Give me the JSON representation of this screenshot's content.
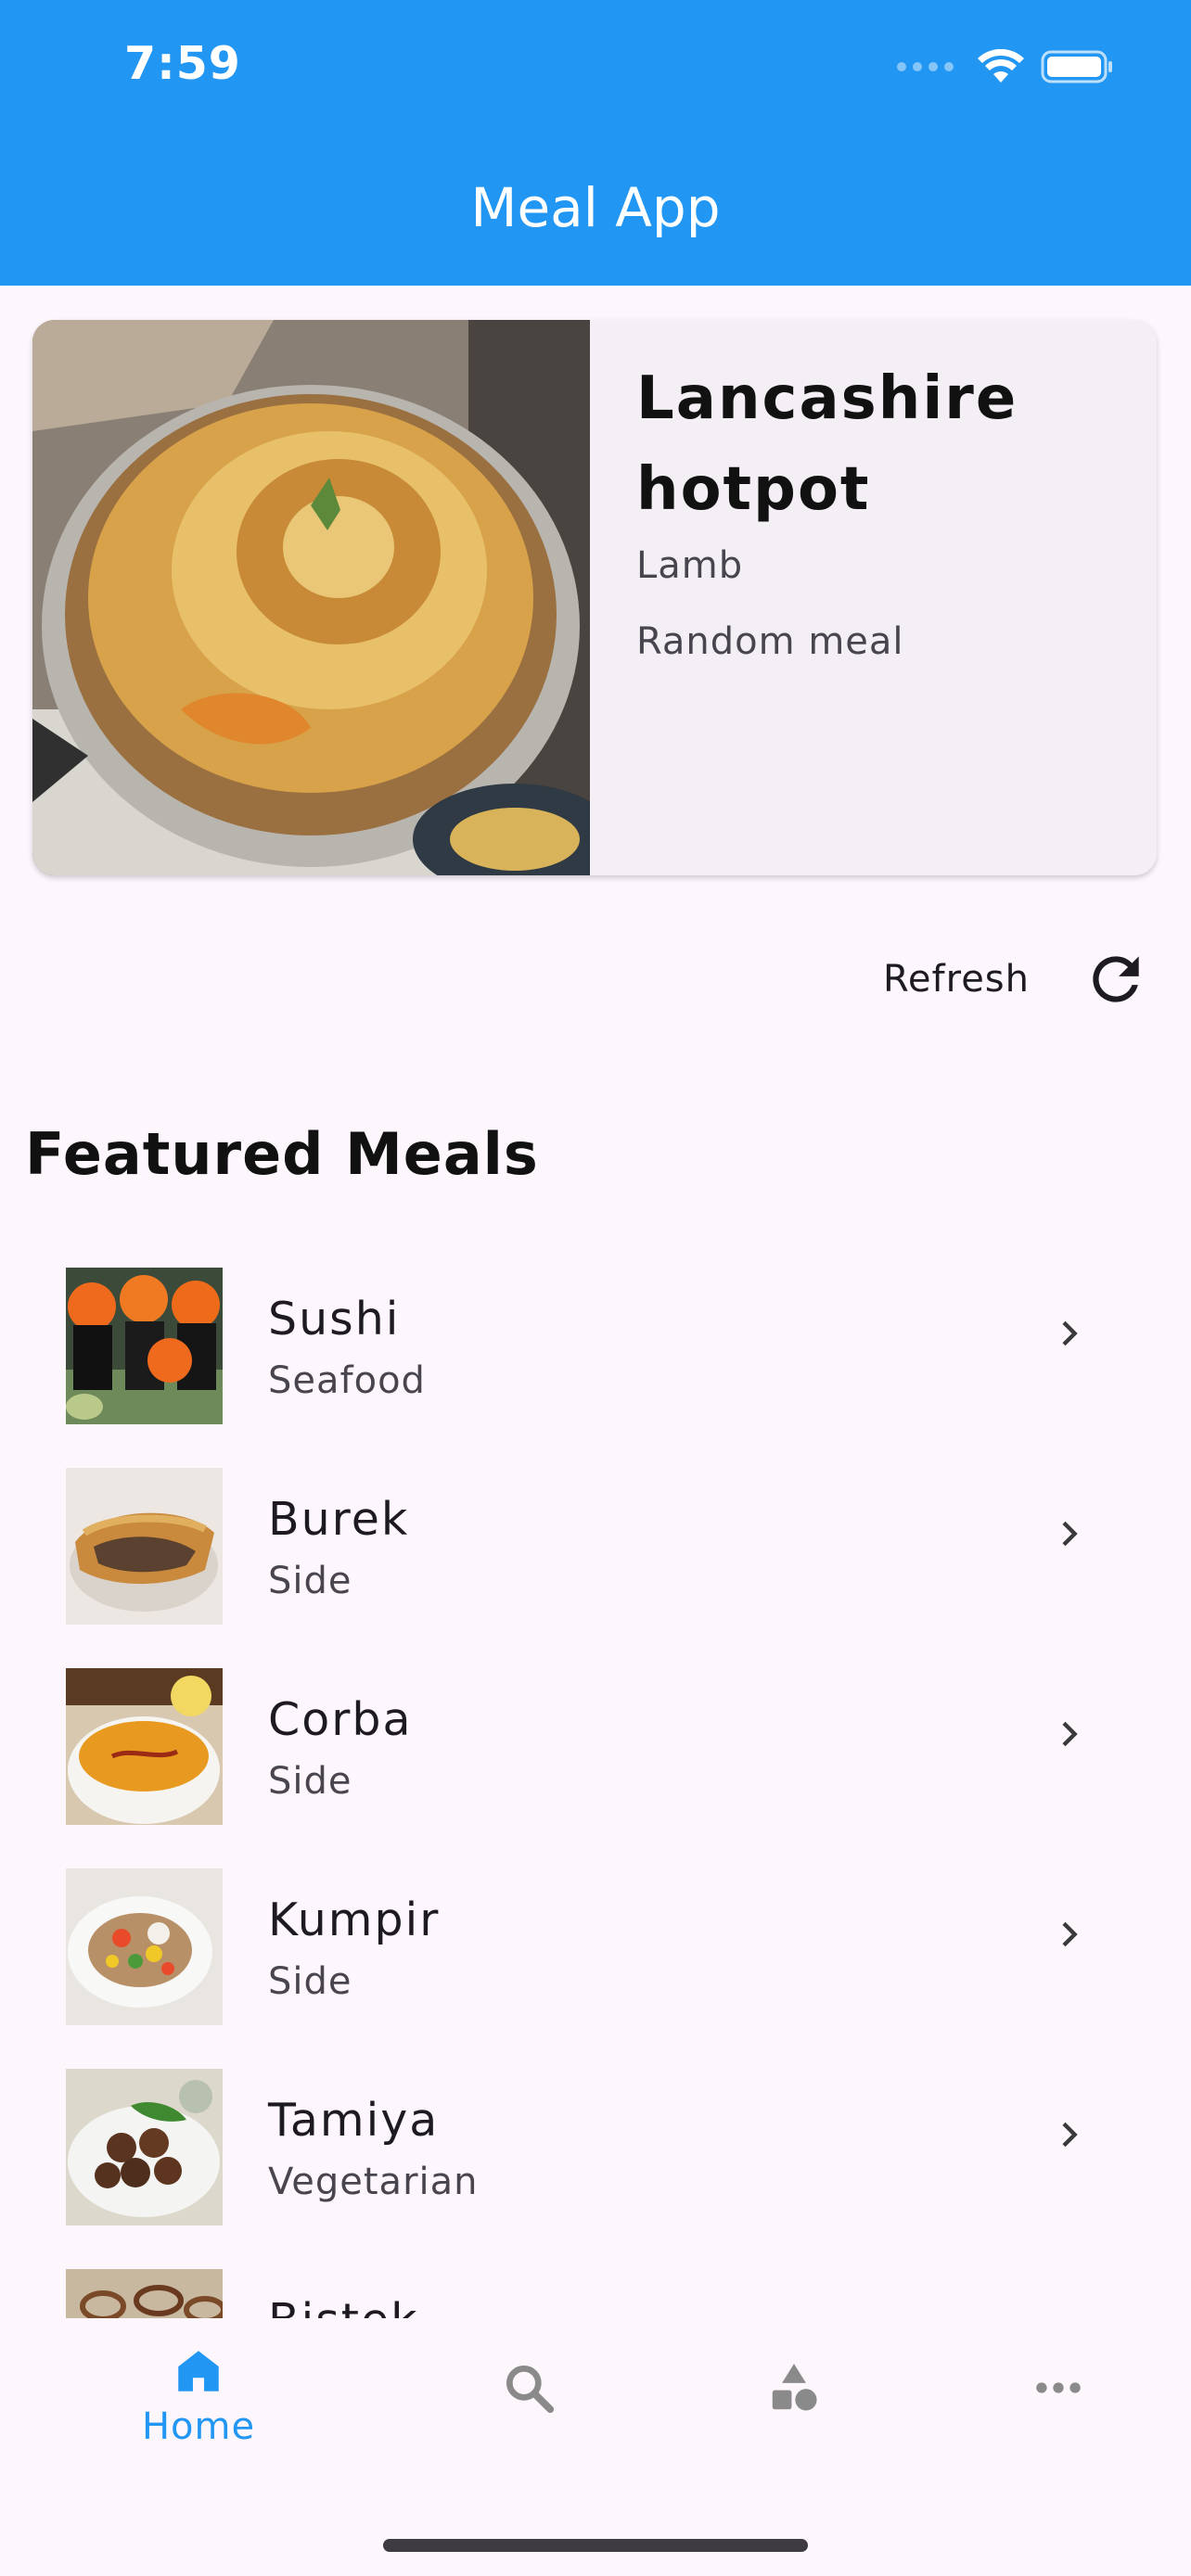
{
  "status_bar": {
    "time": "7:59"
  },
  "app_bar": {
    "title": "Meal App"
  },
  "random_meal": {
    "title": "Lancashire hotpot",
    "category": "Lamb",
    "label": "Random meal"
  },
  "refresh": {
    "label": "Refresh"
  },
  "featured": {
    "title": "Featured Meals",
    "items": [
      {
        "name": "Sushi",
        "category": "Seafood"
      },
      {
        "name": "Burek",
        "category": "Side"
      },
      {
        "name": "Corba",
        "category": "Side"
      },
      {
        "name": "Kumpir",
        "category": "Side"
      },
      {
        "name": "Tamiya",
        "category": "Vegetarian"
      },
      {
        "name": "Bistek",
        "category": ""
      }
    ]
  },
  "bottom_nav": {
    "home_label": "Home",
    "active": "home",
    "icons": [
      "home-icon",
      "search-icon",
      "categories-icon",
      "more-icon"
    ]
  },
  "colors": {
    "primary": "#2196f3",
    "background": "#fdf7fd",
    "card": "#f3eff5"
  }
}
